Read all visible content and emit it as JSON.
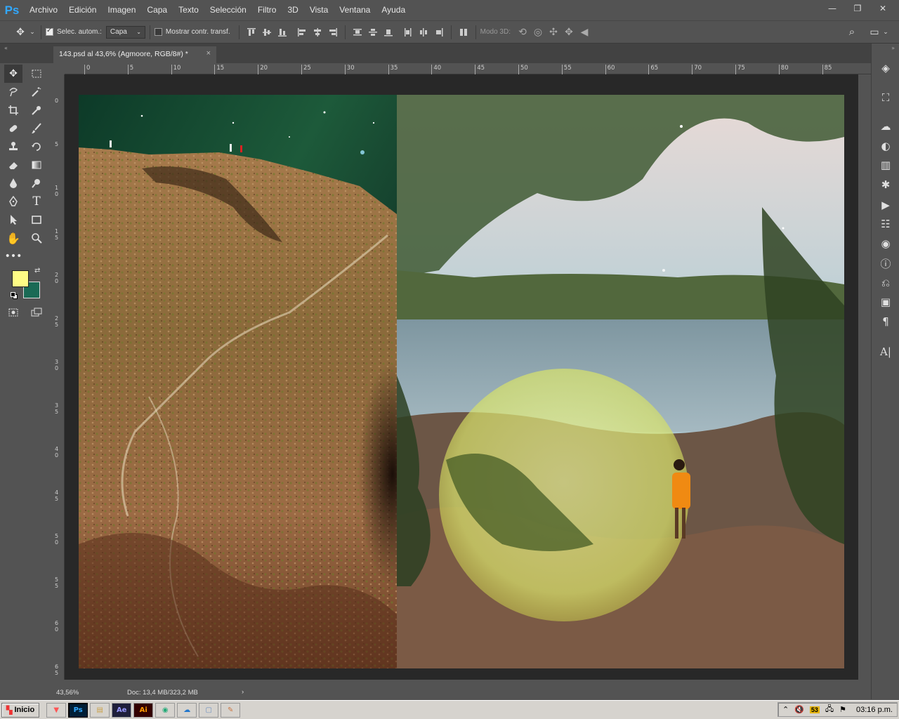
{
  "app": {
    "logo": "Ps"
  },
  "menu": [
    "Archivo",
    "Edición",
    "Imagen",
    "Capa",
    "Texto",
    "Selección",
    "Filtro",
    "3D",
    "Vista",
    "Ventana",
    "Ayuda"
  ],
  "window_controls": [
    "minimize-icon",
    "restore-icon",
    "close-icon"
  ],
  "options": {
    "auto_select_label": "Selec. autom.:",
    "auto_select_checked": true,
    "layer_dropdown": "Capa",
    "show_transform_label": "Mostrar contr. transf.",
    "show_transform_checked": false,
    "mode3d_label": "Modo 3D:"
  },
  "document_tab": {
    "title": "143.psd al 43,6% (Agmoore, RGB/8#) *",
    "close": "×"
  },
  "ruler_top": [
    "0",
    "5",
    "10",
    "15",
    "20",
    "25",
    "30",
    "35",
    "40",
    "45",
    "50",
    "55",
    "60",
    "65",
    "70",
    "75",
    "80",
    "85"
  ],
  "ruler_left": [
    "0",
    "5",
    "1 0",
    "1 5",
    "2 0",
    "2 5",
    "3 0",
    "3 5",
    "4 0",
    "4 5",
    "5 0",
    "5 5",
    "6 0",
    "6 5"
  ],
  "colors": {
    "foreground": "#fefc85",
    "background": "#1a6a55"
  },
  "status": {
    "zoom": "43,56%",
    "doc": "Doc: 13,4 MB/323,2 MB"
  },
  "taskbar": {
    "start": "Inicio",
    "apps": [
      "brave",
      "Ps",
      "explorer",
      "Ae",
      "Ai",
      "chrome",
      "vpn",
      "notes",
      "paint"
    ],
    "time": "03:16 p.m."
  }
}
